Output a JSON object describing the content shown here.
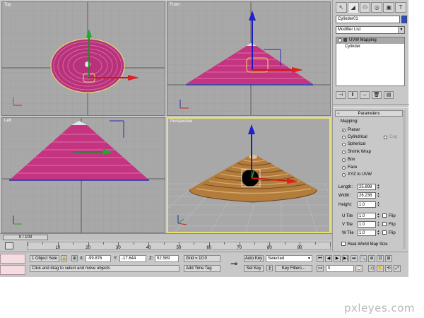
{
  "viewports": {
    "top": {
      "label": "Top"
    },
    "front": {
      "label": "Front"
    },
    "left": {
      "label": "Left"
    },
    "perspective": {
      "label": "Perspective"
    }
  },
  "command_panel": {
    "tabs": [
      "create-icon",
      "modify-icon",
      "hierarchy-icon",
      "motion-icon",
      "display-icon",
      "utilities-icon"
    ],
    "object_name": "Cylinder01",
    "object_color": "#2b4dcc",
    "modifier_list": "Modifier List",
    "stack": [
      {
        "label": "UVW Mapping",
        "selected": true
      },
      {
        "label": "Cylinder",
        "selected": false
      }
    ]
  },
  "parameters": {
    "title": "Parameters",
    "mapping_label": "Mapping:",
    "options": [
      {
        "label": "Planar",
        "selected": true
      },
      {
        "label": "Cylindrical",
        "selected": false
      },
      {
        "label": "Spherical",
        "selected": false
      },
      {
        "label": "Shrink Wrap",
        "selected": false
      },
      {
        "label": "Box",
        "selected": false
      },
      {
        "label": "Face",
        "selected": false
      },
      {
        "label": "XYZ to UVW",
        "selected": false
      }
    ],
    "cap_label": "Cap",
    "length_label": "Length:",
    "length_value": "25.898",
    "width_label": "Width:",
    "width_value": "26.238",
    "height_label": "Height:",
    "height_value": "1.0",
    "utile_label": "U Tile",
    "utile_value": "1.0",
    "vtile_label": "V Tile",
    "vtile_value": "1.0",
    "wtile_label": "W Tile",
    "wtile_value": "1.0",
    "flip_label": "Flip",
    "realworld_label": "Real-World Map Size"
  },
  "timeline": {
    "frame_display": "0 / 100",
    "ticks": [
      "10",
      "20",
      "30",
      "40",
      "50",
      "60",
      "70",
      "80",
      "90"
    ]
  },
  "status": {
    "selection": "1 Object Sele",
    "x_label": "X:",
    "x_value": "-99.876",
    "y_label": "Y:",
    "y_value": "-17.644",
    "z_label": "Z:",
    "z_value": "52.589",
    "grid": "Grid = 10.0",
    "prompt": "Click and drag to select and move objects",
    "add_time_tag": "Add Time Tag",
    "auto_key": "Auto Key",
    "set_key": "Set Key",
    "key_mode": "Selected",
    "key_filters": "Key Filters...",
    "current_frame": "0"
  },
  "watermark": "pxleyes.com"
}
